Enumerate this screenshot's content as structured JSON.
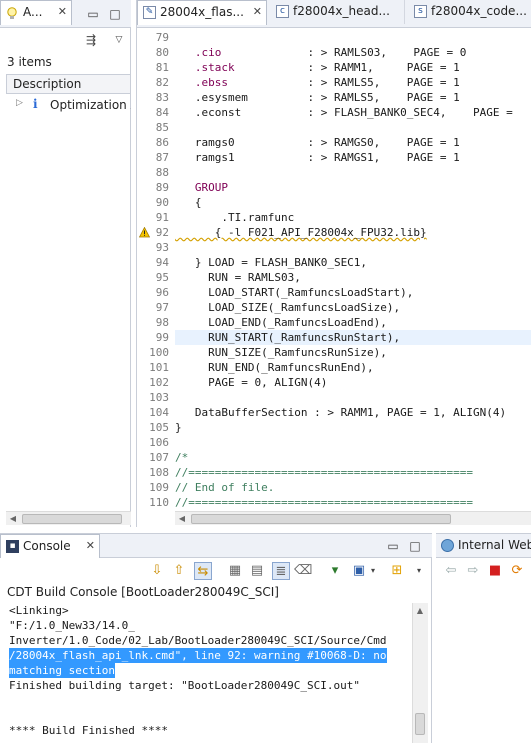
{
  "left_view": {
    "tab_label": "A...",
    "items_count": "3 items",
    "column_header": "Description",
    "tree_item": "Optimization A"
  },
  "editor": {
    "tabs": [
      {
        "label": "28004x_flas...",
        "icon": "linker-file-icon"
      },
      {
        "label": "f28004x_head...",
        "icon": "c-file-icon"
      },
      {
        "label": "f28004x_code...",
        "icon": "c-file-icon"
      }
    ],
    "lines": [
      {
        "n": "79",
        "text": ""
      },
      {
        "n": "80",
        "text": "   .cio             : > RAMLS03,    PAGE = 0"
      },
      {
        "n": "81",
        "text": "   .stack           : > RAMM1,     PAGE = 1"
      },
      {
        "n": "82",
        "text": "   .ebss            : > RAMLS5,    PAGE = 1"
      },
      {
        "n": "83",
        "text": "   .esysmem         : > RAMLS5,    PAGE = 1"
      },
      {
        "n": "84",
        "text": "   .econst          : > FLASH_BANK0_SEC4,    PAGE ="
      },
      {
        "n": "85",
        "text": ""
      },
      {
        "n": "86",
        "text": "   ramgs0           : > RAMGS0,    PAGE = 1"
      },
      {
        "n": "87",
        "text": "   ramgs1           : > RAMGS1,    PAGE = 1"
      },
      {
        "n": "88",
        "text": ""
      },
      {
        "n": "89",
        "text": "   GROUP"
      },
      {
        "n": "90",
        "text": "   {"
      },
      {
        "n": "91",
        "text": "       .TI.ramfunc"
      },
      {
        "n": "92",
        "text": "      { -l F021_API_F28004x_FPU32.lib}"
      },
      {
        "n": "93",
        "text": ""
      },
      {
        "n": "94",
        "text": "   } LOAD = FLASH_BANK0_SEC1,"
      },
      {
        "n": "95",
        "text": "     RUN = RAMLS03,"
      },
      {
        "n": "96",
        "text": "     LOAD_START(_RamfuncsLoadStart),"
      },
      {
        "n": "97",
        "text": "     LOAD_SIZE(_RamfuncsLoadSize),"
      },
      {
        "n": "98",
        "text": "     LOAD_END(_RamfuncsLoadEnd),"
      },
      {
        "n": "99",
        "text": "     RUN_START(_RamfuncsRunStart),"
      },
      {
        "n": "100",
        "text": "     RUN_SIZE(_RamfuncsRunSize),"
      },
      {
        "n": "101",
        "text": "     RUN_END(_RamfuncsRunEnd),"
      },
      {
        "n": "102",
        "text": "     PAGE = 0, ALIGN(4)"
      },
      {
        "n": "103",
        "text": ""
      },
      {
        "n": "104",
        "text": "   DataBufferSection : > RAMM1, PAGE = 1, ALIGN(4)"
      },
      {
        "n": "105",
        "text": "}"
      },
      {
        "n": "106",
        "text": ""
      },
      {
        "n": "107",
        "text": "/*"
      },
      {
        "n": "108",
        "text": "//==========================================="
      },
      {
        "n": "109",
        "text": "// End of file."
      },
      {
        "n": "110",
        "text": "//==========================================="
      }
    ],
    "warning_line": "92",
    "current_line": "99"
  },
  "console": {
    "tab_label": "Console",
    "title": "CDT Build Console [BootLoader280049C_SCI]",
    "output": [
      {
        "text": "<Linking>",
        "style": "normal"
      },
      {
        "text": "\"F:/1.0_New33/14.0_",
        "style": "normal"
      },
      {
        "text": "Inverter/1.0_Code/02_Lab/BootLoader280049C_SCI/Source/Cmd",
        "style": "normal"
      },
      {
        "text": "/28004x_flash_api_lnk.cmd\", line 92: warning #10068-D: no",
        "style": "selected"
      },
      {
        "text": "matching section",
        "style": "selected"
      },
      {
        "text": "Finished building target: \"BootLoader280049C_SCI.out\"",
        "style": "normal"
      },
      {
        "text": "",
        "style": "normal"
      },
      {
        "text": "",
        "style": "normal"
      },
      {
        "text": "**** Build Finished ****",
        "style": "normal"
      }
    ]
  },
  "web": {
    "tab_label": "Internal Web"
  },
  "colors": {
    "keyword": "#7f0055",
    "comment": "#3f7f5f",
    "selection": "#3399ff",
    "current_line": "#e8f2fe"
  }
}
